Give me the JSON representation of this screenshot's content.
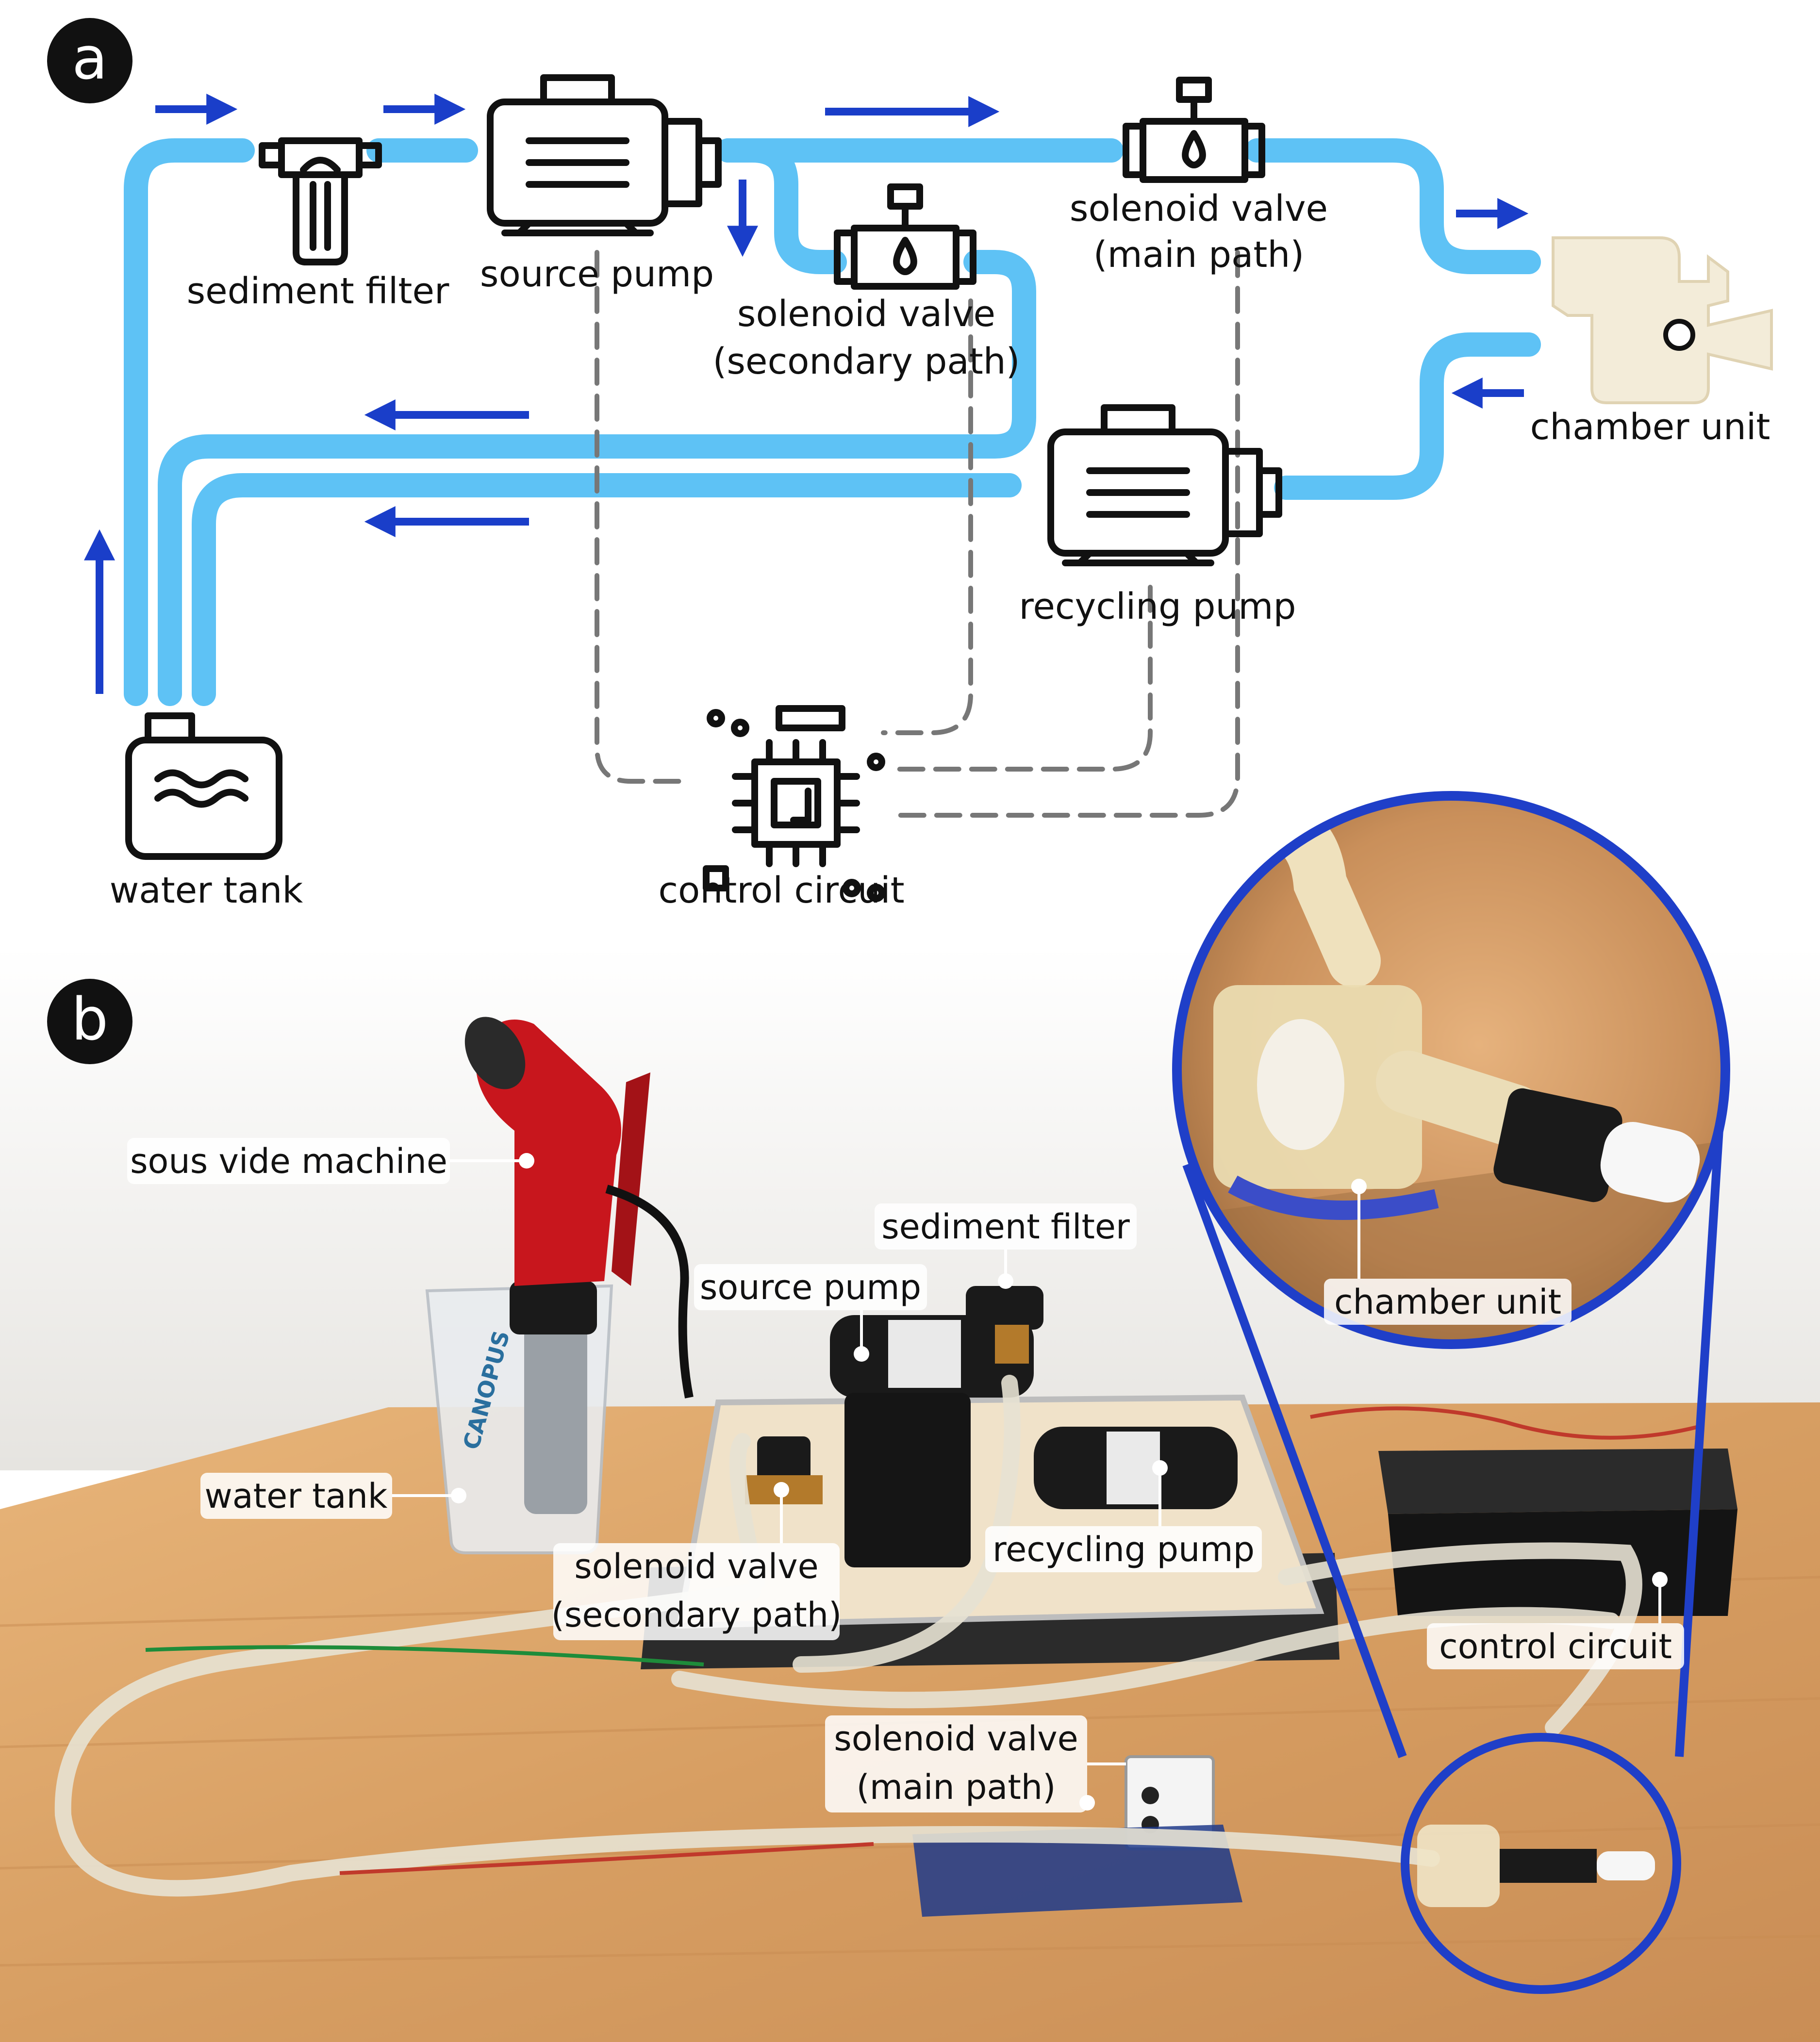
{
  "panel_a": {
    "letter": "a",
    "labels": {
      "sediment_filter": "sediment filter",
      "source_pump": "source pump",
      "valve_secondary_line1": "solenoid valve",
      "valve_secondary_line2": "(secondary path)",
      "valve_main_line1": "solenoid valve",
      "valve_main_line2": "(main path)",
      "chamber_unit": "chamber unit",
      "recycling_pump": "recycling pump",
      "water_tank": "water tank",
      "control_circuit": "control circuit"
    }
  },
  "panel_b": {
    "letter": "b",
    "labels": {
      "sous_vide": "sous vide machine",
      "sediment_filter": "sediment filter",
      "source_pump": "source pump",
      "water_tank": "water tank",
      "valve_secondary_line1": "solenoid valve",
      "valve_secondary_line2": "(secondary path)",
      "recycling_pump": "recycling pump",
      "control_circuit": "control circuit",
      "valve_main_line1": "solenoid valve",
      "valve_main_line2": "(main path)",
      "chamber_unit": "chamber unit",
      "beaker_brand": "CANOPUS"
    }
  },
  "colors": {
    "pipe": "#5ec2f5",
    "flow_arrow": "#1a3ec9",
    "signal_wire": "#777777",
    "zoom_circle": "#1f3fc8",
    "sous_vide_red": "#c8161d",
    "table_wood": "#d9a36a"
  }
}
